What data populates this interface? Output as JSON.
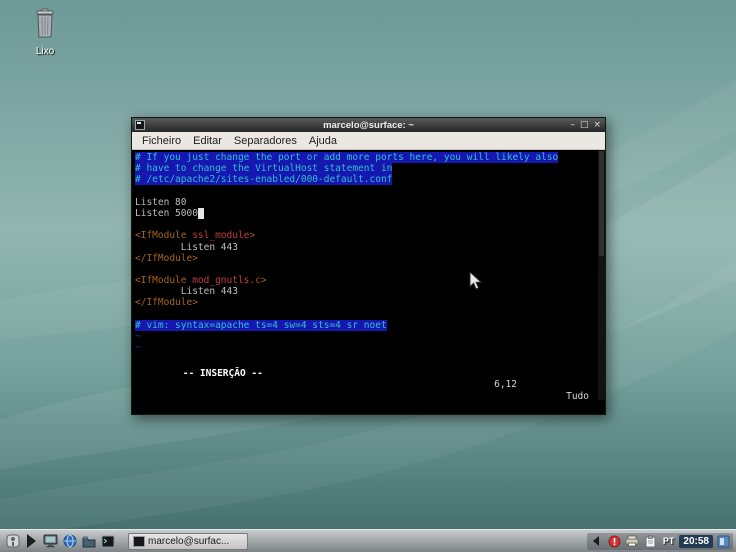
{
  "desktop": {
    "trash_label": "Lixo"
  },
  "window": {
    "title": "marcelo@surface: ~",
    "controls": {
      "minimize": "–",
      "maximize": "□",
      "close": "×"
    },
    "menus": [
      {
        "label": "Ficheiro"
      },
      {
        "label": "Editar"
      },
      {
        "label": "Separadores"
      },
      {
        "label": "Ajuda"
      }
    ]
  },
  "terminal": {
    "lines": [
      [
        {
          "t": "# If you just change the port or add more ports here, you will likely also",
          "c": "comment"
        }
      ],
      [
        {
          "t": "# have to change the VirtualHost statement in",
          "c": "comment"
        }
      ],
      [
        {
          "t": "# /etc/apache2/sites-enabled/000-default.conf",
          "c": "comment"
        }
      ],
      [],
      [
        {
          "t": "Listen 80",
          "c": "plain"
        }
      ],
      [
        {
          "t": "Listen 5000",
          "c": "plain"
        },
        {
          "t": " ",
          "c": "cursor"
        }
      ],
      [],
      [
        {
          "t": "<IfModule ",
          "c": "tag"
        },
        {
          "t": "ssl_module",
          "c": "module"
        },
        {
          "t": ">",
          "c": "tag"
        }
      ],
      [
        {
          "t": "        Listen 443",
          "c": "plain"
        }
      ],
      [
        {
          "t": "</IfModule>",
          "c": "tag"
        }
      ],
      [],
      [
        {
          "t": "<IfModule ",
          "c": "tag"
        },
        {
          "t": "mod_gnutls.c",
          "c": "module"
        },
        {
          "t": ">",
          "c": "tag"
        }
      ],
      [
        {
          "t": "        Listen 443",
          "c": "plain"
        }
      ],
      [
        {
          "t": "</IfModule>",
          "c": "tag"
        }
      ],
      [],
      [
        {
          "t": "# vim: syntax=apache ts=4 sw=4 sts=4 sr noet",
          "c": "comment"
        }
      ],
      [
        {
          "t": "~",
          "c": "tilde"
        }
      ],
      [
        {
          "t": "~",
          "c": "tilde"
        }
      ],
      [
        {
          "t": "~",
          "c": "tilde"
        }
      ],
      [
        {
          "t": "~",
          "c": "tilde"
        }
      ],
      [
        {
          "t": "~",
          "c": "tilde"
        }
      ],
      [
        {
          "t": "~",
          "c": "tilde"
        }
      ]
    ],
    "status": {
      "mode": "-- INSERÇÃO --",
      "position": "6,12",
      "scroll": "Tudo"
    }
  },
  "taskbar": {
    "launchers": [
      "app-menu-icon",
      "show-desktop-icon",
      "display-icon",
      "browser-globe-icon",
      "file-manager-icon",
      "terminal-launcher-icon"
    ],
    "tray_icons": [
      "tray-collapse-arrow-icon",
      "update-notifier-icon",
      "printer-icon",
      "clipboard-icon",
      "workspace-applet-icon"
    ],
    "window_button_label": "marcelo@surfac...",
    "keyboard_layout": "PT",
    "clock": "20:58"
  },
  "colors": {
    "desktop_teal": "#7ba5a1",
    "comment_bg": "#1616b0",
    "comment_fg": "#2fc1cd",
    "tag_fg": "#a8641c",
    "module_fg": "#c23b3b",
    "plain_fg": "#bdbdbd",
    "tilde_fg": "#2433c8",
    "clock_bg": "#223a52"
  }
}
